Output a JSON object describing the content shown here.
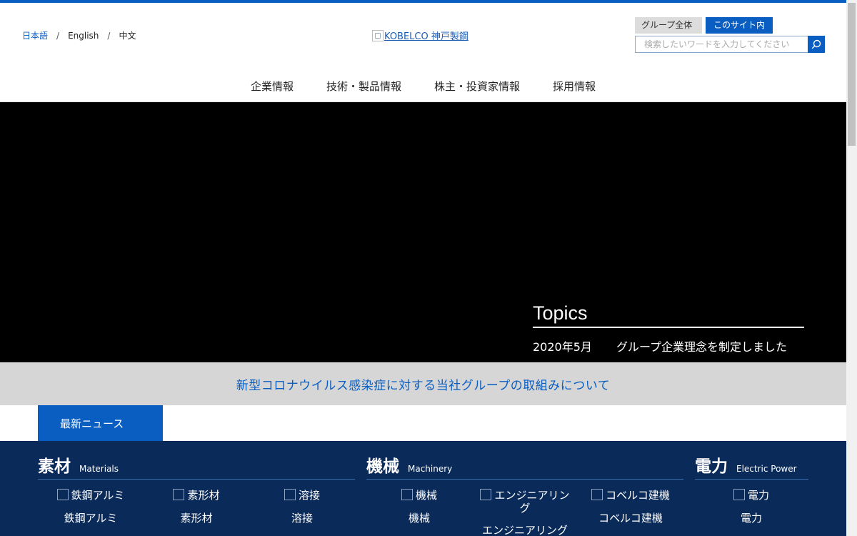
{
  "language": {
    "items": [
      "日本語",
      "English",
      "中文"
    ],
    "separator": "/"
  },
  "logo": {
    "alt": "KOBELCO 神戸製鋼"
  },
  "search": {
    "tabs": [
      "グループ全体",
      "このサイト内"
    ],
    "placeholder": "検索したいワードを入力してください",
    "button_icon": "search-icon"
  },
  "global_nav": [
    "企業情報",
    "技術・製品情報",
    "株主・投資家情報",
    "採用情報"
  ],
  "hero": {
    "topics_title": "Topics",
    "topic": {
      "date": "2020年5月",
      "text": "グループ企業理念を制定しました"
    }
  },
  "notice": {
    "text": "新型コロナウイルス感染症に対する当社グループの取組みについて"
  },
  "news_tab": {
    "label": "最新ニュース"
  },
  "business": {
    "materials": {
      "title_jp": "素材",
      "title_en": "Materials",
      "items": [
        {
          "alt": "鉄鋼アルミ",
          "label": "鉄鋼アルミ"
        },
        {
          "alt": "素形材",
          "label": "素形材"
        },
        {
          "alt": "溶接",
          "label": "溶接"
        }
      ]
    },
    "machinery": {
      "title_jp": "機械",
      "title_en": "Machinery",
      "items": [
        {
          "alt": "機械",
          "label": "機械"
        },
        {
          "alt": "エンジニアリング",
          "label": "エンジニアリング"
        },
        {
          "alt": "コベルコ建機",
          "label": "コベルコ建機"
        }
      ]
    },
    "power": {
      "title_jp": "電力",
      "title_en": "Electric Power",
      "items": [
        {
          "alt": "電力",
          "label": "電力"
        }
      ]
    }
  },
  "colors": {
    "brand_blue": "#0a5ec2",
    "navy": "#0a2a5a",
    "notice_gray": "#d6d6d6"
  }
}
